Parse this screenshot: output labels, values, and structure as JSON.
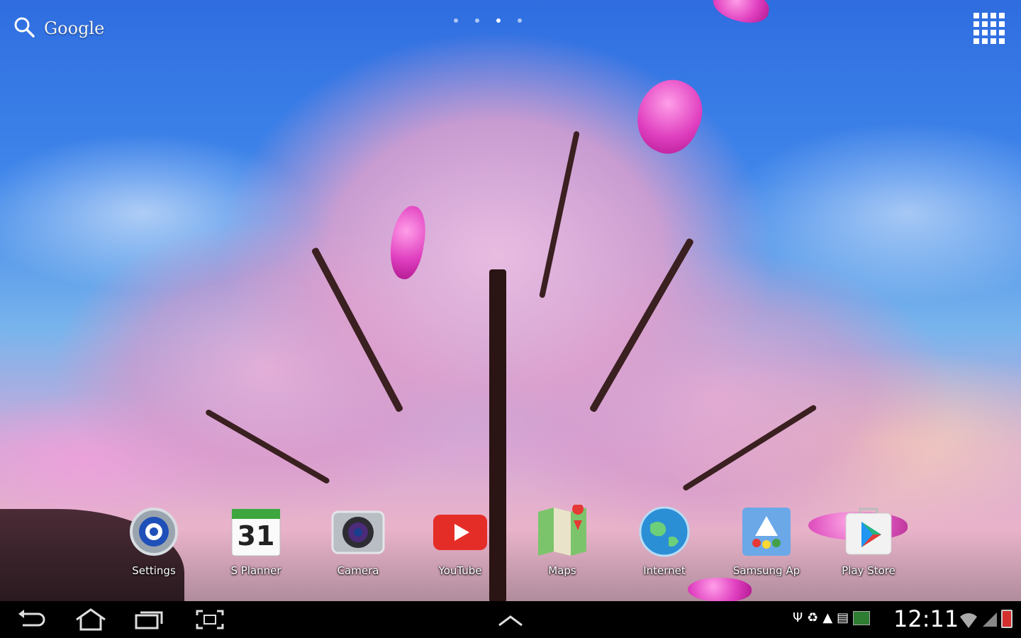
{
  "search": {
    "label": "Google"
  },
  "apps": [
    {
      "label": "Settings",
      "icon": "settings-gear-icon"
    },
    {
      "label": "S Planner",
      "icon": "calendar-icon",
      "day": "31"
    },
    {
      "label": "Camera",
      "icon": "camera-icon"
    },
    {
      "label": "YouTube",
      "icon": "youtube-icon"
    },
    {
      "label": "Maps",
      "icon": "maps-icon"
    },
    {
      "label": "Internet",
      "icon": "globe-icon"
    },
    {
      "label": "Samsung Ap",
      "icon": "samsung-apps-icon"
    },
    {
      "label": "Play Store",
      "icon": "play-store-icon"
    }
  ],
  "status": {
    "time": "12:11"
  },
  "colors": {
    "youtube": "#e52d27",
    "navbar": "#000000",
    "sky": "#3f86ea",
    "blossom": "#e9b3d6"
  }
}
